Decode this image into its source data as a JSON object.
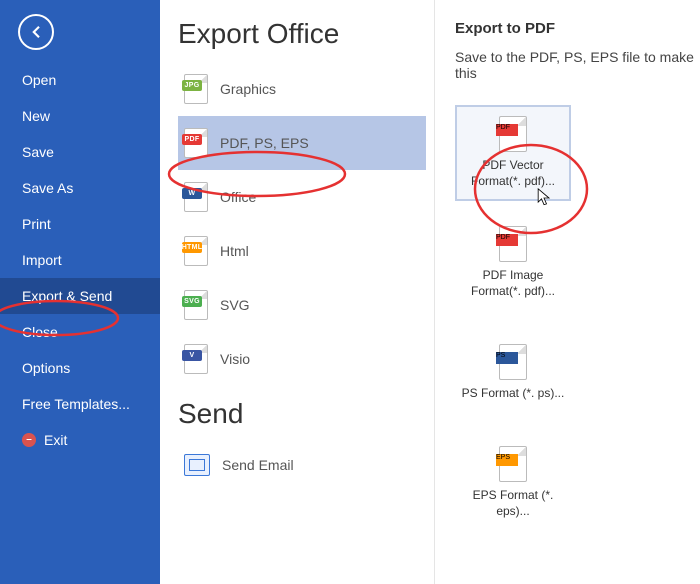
{
  "sidebar": {
    "items": [
      {
        "label": "Open"
      },
      {
        "label": "New"
      },
      {
        "label": "Save"
      },
      {
        "label": "Save As"
      },
      {
        "label": "Print"
      },
      {
        "label": "Import"
      },
      {
        "label": "Export & Send"
      },
      {
        "label": "Close"
      },
      {
        "label": "Options"
      },
      {
        "label": "Free Templates..."
      },
      {
        "label": "Exit"
      }
    ]
  },
  "export": {
    "heading": "Export Office",
    "items": [
      {
        "label": "Graphics",
        "tag": "JPG"
      },
      {
        "label": "PDF, PS, EPS",
        "tag": "PDF"
      },
      {
        "label": "Office",
        "tag": "W"
      },
      {
        "label": "Html",
        "tag": "HTML"
      },
      {
        "label": "SVG",
        "tag": "SVG"
      },
      {
        "label": "Visio",
        "tag": "V"
      }
    ],
    "send_heading": "Send",
    "send_items": [
      {
        "label": "Send Email"
      }
    ]
  },
  "right": {
    "heading": "Export to PDF",
    "desc": "Save to the PDF, PS, EPS file to make this",
    "tiles": [
      {
        "label": "PDF Vector Format(*. pdf)...",
        "tag": "PDF"
      },
      {
        "label": "PDF Image Format(*. pdf)...",
        "tag": "PDF"
      },
      {
        "label": "PS Format (*. ps)...",
        "tag": "PS"
      },
      {
        "label": "EPS Format (*. eps)...",
        "tag": "EPS"
      }
    ]
  }
}
